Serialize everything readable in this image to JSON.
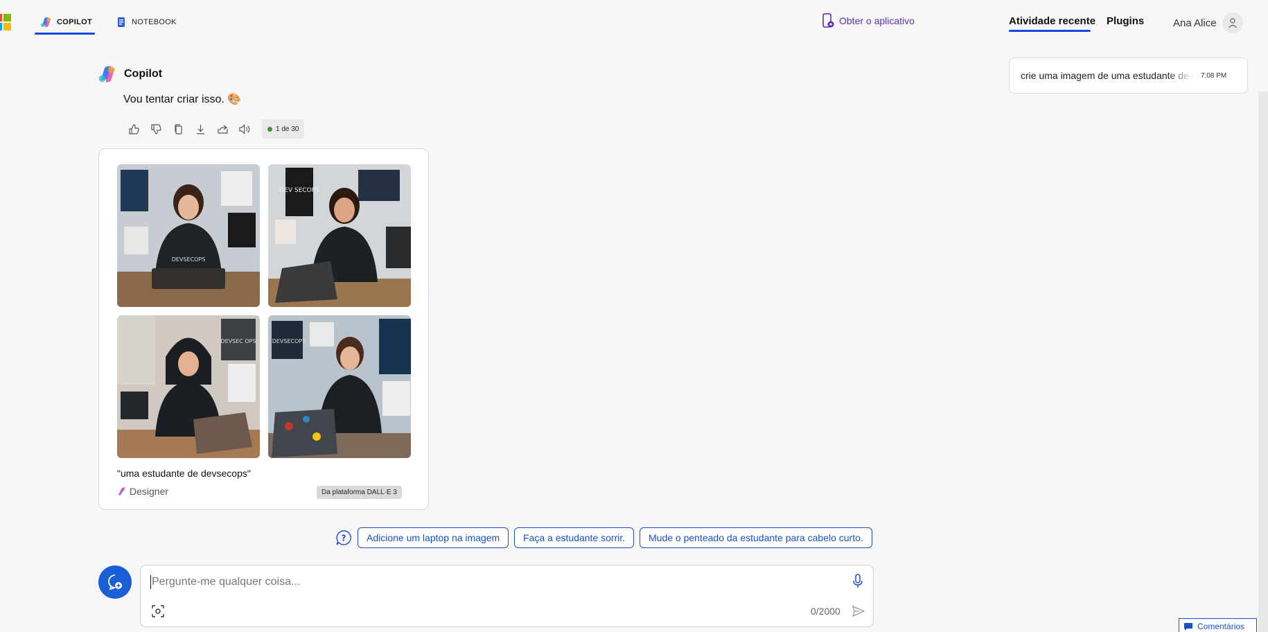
{
  "nav": {
    "tabs": [
      {
        "label": "COPILOT",
        "icon": "copilot-logo-icon",
        "active": true
      },
      {
        "label": "NOTEBOOK",
        "icon": "notebook-icon",
        "active": false
      }
    ],
    "get_app": "Obter o aplicativo",
    "right_tabs": [
      "Atividade recente",
      "Plugins"
    ],
    "user_name": "Ana Alice"
  },
  "recent": {
    "text": "crie uma imagem de uma estudante de devsecops",
    "time": "7:08 PM"
  },
  "chat": {
    "bot_name": "Copilot",
    "message": "Vou tentar criar isso. 🎨",
    "counter": "1 de 30",
    "actions": [
      "thumbs-up-icon",
      "thumbs-down-icon",
      "copy-icon",
      "download-icon",
      "share-icon",
      "speaker-icon"
    ]
  },
  "image_card": {
    "caption": "\"uma estudante de devsecops\"",
    "source": "Designer",
    "badge": "Da plataforma DALL·E 3",
    "thumb_labels": [
      "DEVSECOPS",
      "DEV SECOPS",
      "DEVSEC OPS",
      "DEVSECOPS"
    ]
  },
  "suggestions": [
    "Adicione um laptop na imagem",
    "Faça a estudante sorrir.",
    "Mude o penteado da estudante para cabelo curto."
  ],
  "input": {
    "placeholder": "Pergunte-me qualquer coisa...",
    "char_count": "0/2000"
  },
  "feedback": "Comentários",
  "colors": {
    "accent": "#174ae4",
    "link": "#1a4fd0",
    "app_link": "#5b2fb0",
    "background": "#f7f7f7"
  }
}
